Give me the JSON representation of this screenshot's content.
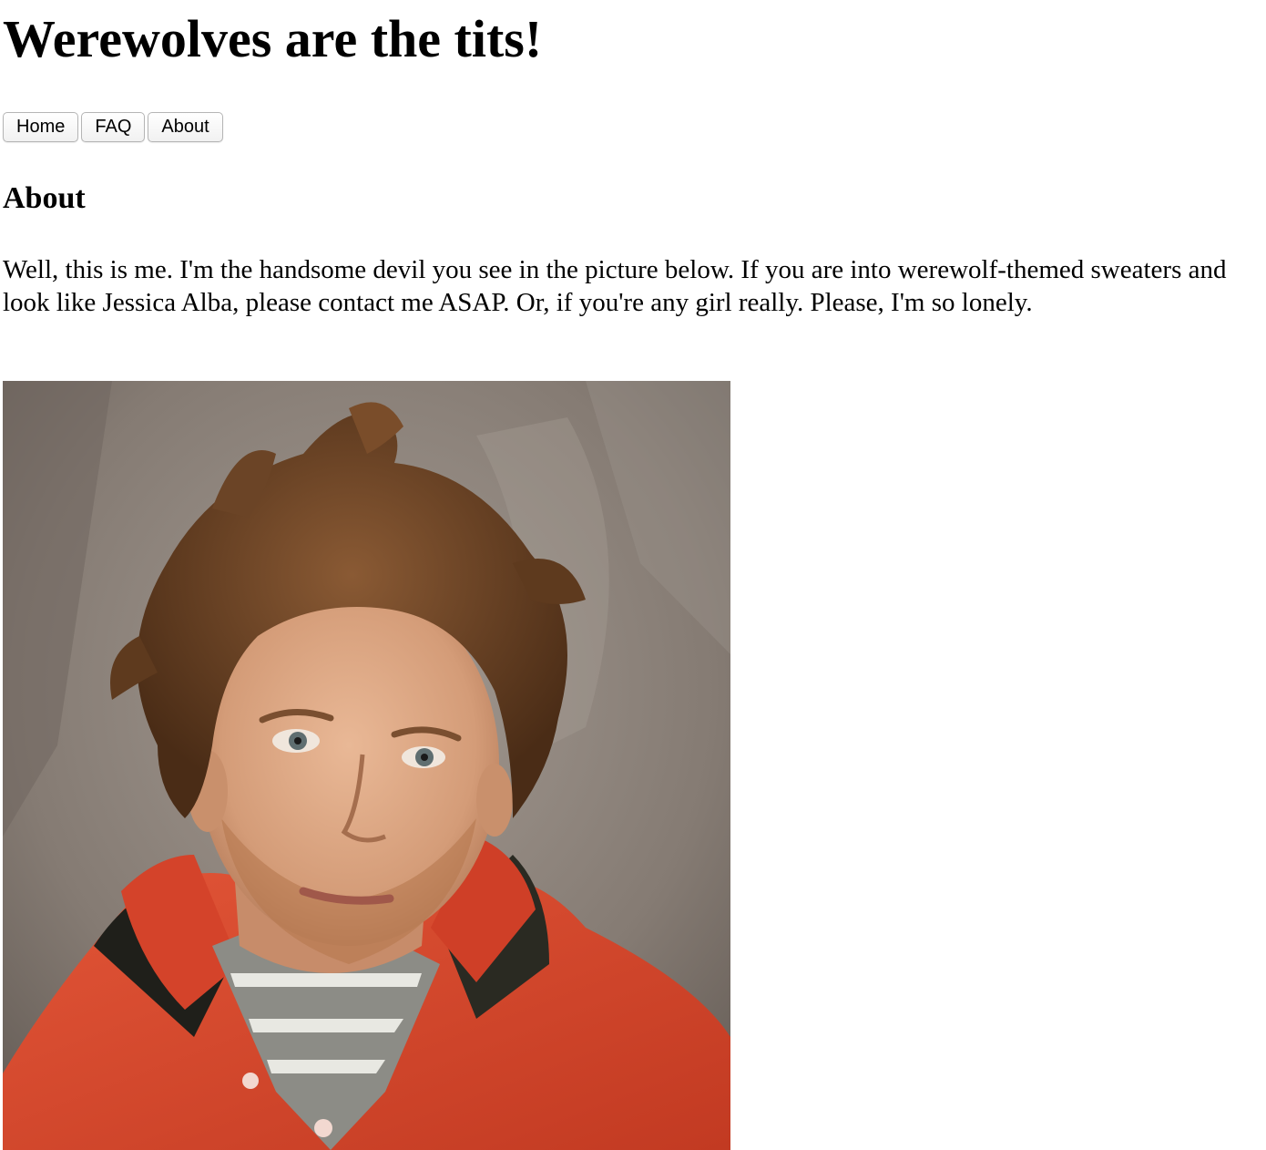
{
  "header": {
    "title": "Werewolves are the tits!"
  },
  "nav": {
    "items": [
      {
        "label": "Home"
      },
      {
        "label": "FAQ"
      },
      {
        "label": "About"
      }
    ]
  },
  "main": {
    "heading": "About",
    "paragraph": "Well, this is me. I'm the handsome devil you see in the picture below. If you are into werewolf-themed sweaters and look like Jessica Alba, please contact me ASAP. Or, if you're any girl really. Please, I'm so lonely."
  },
  "colors": {
    "background": "#ffffff",
    "text": "#000000",
    "photo_backdrop": "#8a8078",
    "shirt": "#d9452b",
    "hair": "#6b4426",
    "skin": "#d9a482"
  }
}
